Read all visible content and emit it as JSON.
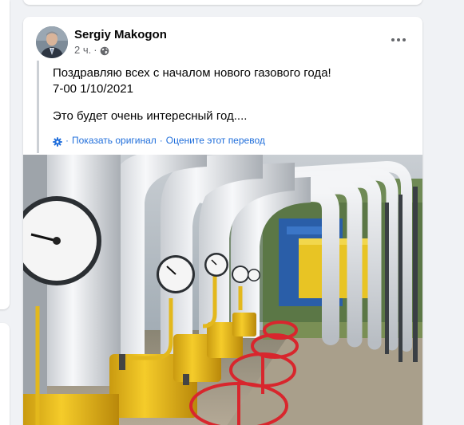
{
  "post": {
    "author": "Sergiy Makogon",
    "time": "2 ч.",
    "dot": "·",
    "text_line1": "Поздравляю всех с началом нового газового года!",
    "text_line2": "7-00 1/10/2021",
    "text_line3": "Это будет очень интересный год....",
    "translation": {
      "prefix": "·",
      "show_original": "Показать оригинал",
      "separator": "·",
      "rate": "Оцените этот перевод"
    },
    "audience_icon": "globe-icon",
    "translation_icon": "gear-icon",
    "photo_subject": "gas pipelines with pressure gauges and red valves"
  },
  "colors": {
    "link": "#216fdb",
    "muted": "#65676b",
    "background": "#f0f2f5"
  }
}
